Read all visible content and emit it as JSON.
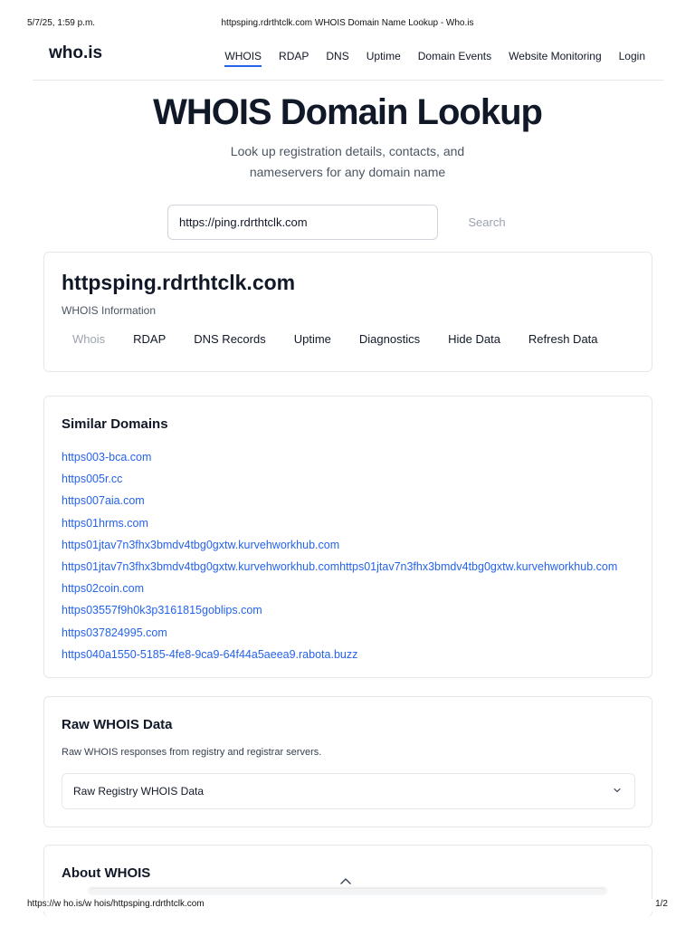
{
  "print": {
    "date": "5/7/25, 1:59 p.m.",
    "page_title": "httpsping.rdrthtclk.com WHOIS Domain Name Lookup - Who.is",
    "url": "https://w ho.is/w hois/httpsping.rdrthtclk.com",
    "page_number": "1/2"
  },
  "nav": {
    "logo": "who.is",
    "links": [
      "WHOIS",
      "RDAP",
      "DNS",
      "Uptime",
      "Domain Events",
      "Website Monitoring",
      "Login"
    ],
    "active_index": 0
  },
  "hero": {
    "title": "WHOIS Domain Lookup",
    "subtitle_line1": "Look up registration details, contacts, and",
    "subtitle_line2": "nameservers for any domain name"
  },
  "search": {
    "value": "https://ping.rdrthtclk.com",
    "button_label": "Search"
  },
  "domain_card": {
    "domain": "httpsping.rdrthtclk.com",
    "subtitle": "WHOIS Information",
    "tabs": [
      "Whois",
      "RDAP",
      "DNS Records",
      "Uptime",
      "Diagnostics",
      "Hide Data",
      "Refresh Data"
    ],
    "active_tab_index": 0
  },
  "similar": {
    "heading": "Similar Domains",
    "items": [
      "https003-bca.com",
      "https005r.cc",
      "https007aia.com",
      "https01hrms.com",
      "https01jtav7n3fhx3bmdv4tbg0gxtw.kurvehworkhub.com",
      "https01jtav7n3fhx3bmdv4tbg0gxtw.kurvehworkhub.comhttps01jtav7n3fhx3bmdv4tbg0gxtw.kurvehworkhub.com",
      "https02coin.com",
      "https03557f9h0k3p3161815goblips.com",
      "https037824995.com",
      "https040a1550-5185-4fe8-9ca9-64f44a5aeea9.rabota.buzz"
    ]
  },
  "raw": {
    "heading": "Raw WHOIS Data",
    "description": "Raw WHOIS responses from registry and registrar servers.",
    "accordion_label": "Raw Registry WHOIS Data"
  },
  "about": {
    "heading": "About WHOIS"
  },
  "icons": {
    "chevron": "chevron-down-icon",
    "scroll": "chevron-up-icon"
  },
  "colors": {
    "accent": "#2563eb",
    "muted": "#9ca3af",
    "border": "#e5e7eb"
  }
}
